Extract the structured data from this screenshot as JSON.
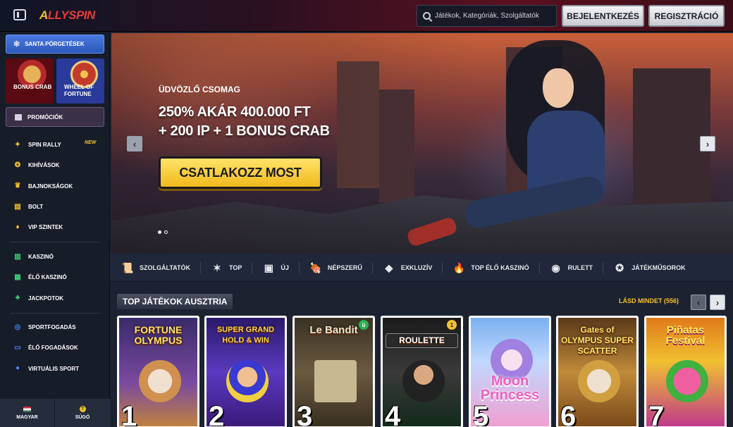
{
  "header": {
    "logo": "ALLYSPIN",
    "logo_first": "A",
    "logo_rest": "LLYSPIN",
    "search_placeholder": "Játékok, Kategóriák, Szolgáltatók",
    "login_label": "Bejelentkezés",
    "register_label": "Regisztráció"
  },
  "sidebar": {
    "santa_label": "SANTA PÖRGETÉSEK",
    "tiles": [
      {
        "label": "BONUS CRAB"
      },
      {
        "label": "WHEEL OF FORTUNE"
      }
    ],
    "promo_label": "PROMÓCIÓK",
    "group1": [
      {
        "label": "SPIN RALLY",
        "badge": "NEW"
      },
      {
        "label": "KIHÍVÁSOK"
      },
      {
        "label": "BAJNOKSÁGOK"
      },
      {
        "label": "BOLT"
      },
      {
        "label": "VIP SZINTEK"
      }
    ],
    "group2": [
      {
        "label": "KASZINÓ"
      },
      {
        "label": "ÉLŐ KASZINÓ"
      },
      {
        "label": "JACKPOTOK"
      }
    ],
    "group3": [
      {
        "label": "SPORTFOGADÁS"
      },
      {
        "label": "ÉLŐ FOGADÁSOK"
      },
      {
        "label": "VIRTUÁLIS SPORT"
      }
    ],
    "language_label": "MAGYAR",
    "help_label": "SÚGÓ",
    "help_glyph": "?"
  },
  "hero": {
    "kicker": "ÜDVÖZLŐ CSOMAG",
    "headline_line1": "250% AKÁR 400.000 FT",
    "headline_line2": "+ 200 IP + 1 BONUS CRAB",
    "cta_label": "CSATLAKOZZ MOST",
    "slide_count": 2,
    "active_slide": 1
  },
  "categories": [
    {
      "label": "SZOLGÁLTATÓK",
      "icon": "scroll-icon",
      "glyph": "📜"
    },
    {
      "label": "TOP",
      "icon": "star-icon",
      "glyph": "✶"
    },
    {
      "label": "ÚJ",
      "icon": "new-box-icon",
      "glyph": "▣"
    },
    {
      "label": "NÉPSZERŰ",
      "icon": "meat-icon",
      "glyph": "🍖"
    },
    {
      "label": "EXKLUZÍV",
      "icon": "diamond-icon",
      "glyph": "◆"
    },
    {
      "label": "TOP ÉLŐ KASZINÓ",
      "icon": "fire-icon",
      "glyph": "🔥"
    },
    {
      "label": "RULETT",
      "icon": "roulette-icon",
      "glyph": "◉"
    },
    {
      "label": "JÁTÉKMŰSOROK",
      "icon": "gameshow-icon",
      "glyph": "✪"
    }
  ],
  "top_games": {
    "title": "TOP JÁTÉKOK AUSZTRIA",
    "see_all": "LÁSD MINDET (556)",
    "games": [
      {
        "rank": "1",
        "title": "FORTUNE OLYMPUS"
      },
      {
        "rank": "2",
        "title": "SUPER GRAND HOLD & WIN"
      },
      {
        "rank": "3",
        "title": "Le Bandit",
        "badge": "ü"
      },
      {
        "rank": "4",
        "title": "ROULETTE",
        "badge": "1"
      },
      {
        "rank": "5",
        "title": "Moon Princess"
      },
      {
        "rank": "6",
        "title": "Gates of OLYMPUS SUPER SCATTER"
      },
      {
        "rank": "7",
        "title": "Piñatas Festival"
      }
    ]
  },
  "colors": {
    "accent_yellow": "#f3c22d",
    "brand_red": "#e83a3a",
    "santa_blue": "#3a68d0",
    "bg_dark": "#1c2230"
  }
}
